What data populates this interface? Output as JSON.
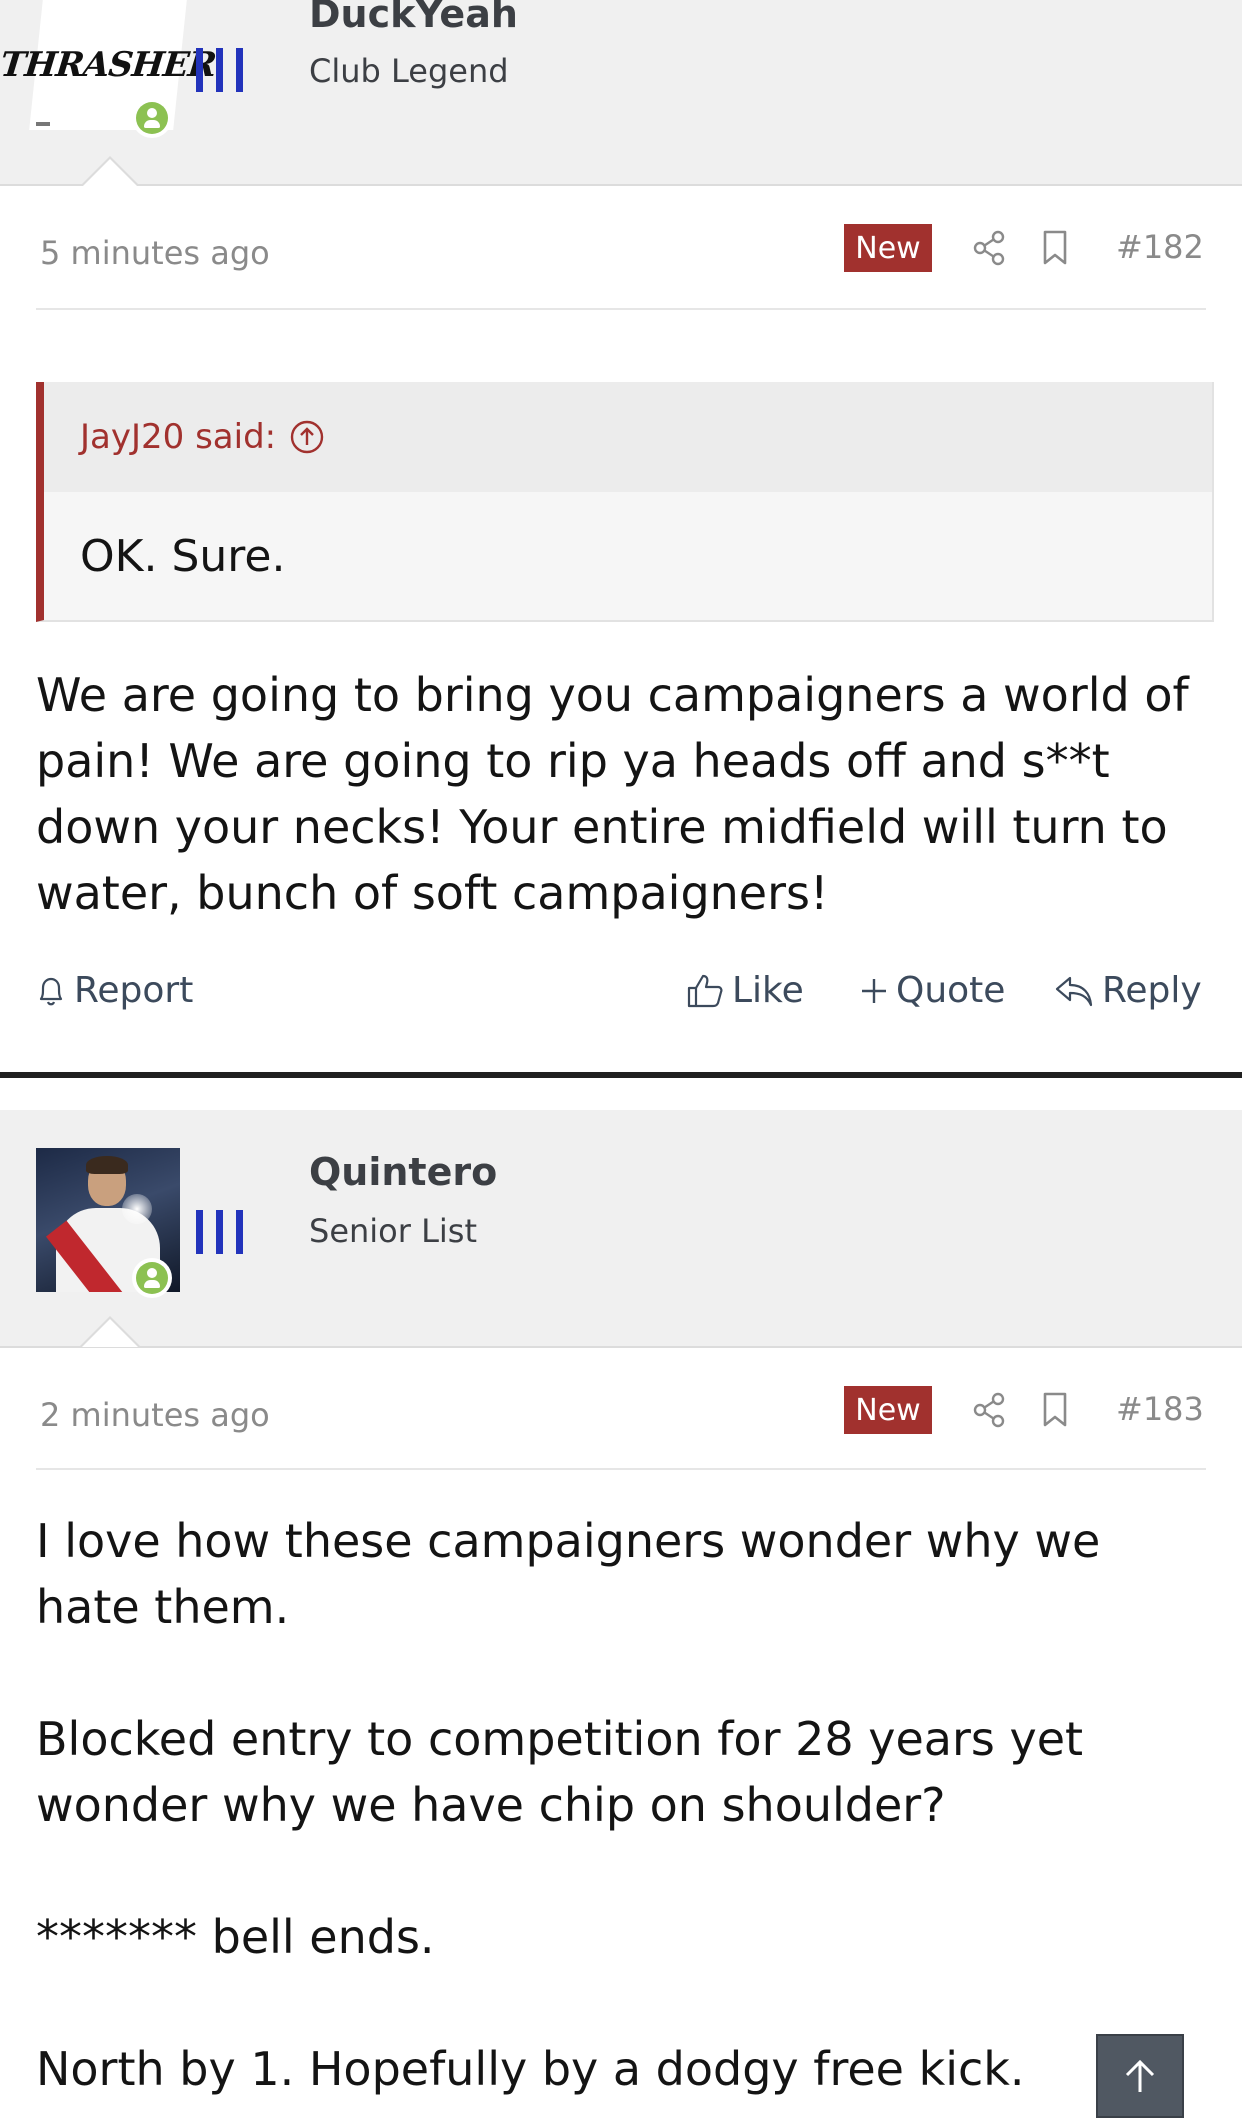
{
  "posts": [
    {
      "username": "DuckYeah",
      "user_title": "Club Legend",
      "avatar_text": "THRASHER",
      "timestamp": "5 minutes ago",
      "badge": "New",
      "number": "#182",
      "quote": {
        "author": "JayJ20 said:",
        "text": "OK. Sure."
      },
      "body": [
        "We are going to bring you campaigners a world of pain! We are going to rip ya heads off and s**t down your necks! Your entire midfield will turn to water, bunch of soft campaigners!"
      ],
      "actions": {
        "report": "Report",
        "like": "Like",
        "quote": "Quote",
        "reply": "Reply"
      }
    },
    {
      "username": "Quintero",
      "user_title": "Senior List",
      "timestamp": "2 minutes ago",
      "badge": "New",
      "number": "#183",
      "body": [
        "I love how these campaigners wonder why we hate them.",
        "Blocked entry to competition for 28 years yet wonder why we have chip on shoulder?",
        "******* bell ends.",
        "North by 1. Hopefully by a dodgy free kick."
      ]
    }
  ],
  "colors": {
    "accent": "#a1312e",
    "online": "#8cc152",
    "flag": "#2233bb"
  },
  "icons": [
    "share-icon",
    "bookmark-icon",
    "bell-icon",
    "thumbs-up-icon",
    "plus-icon",
    "reply-icon",
    "arrow-up-circle-icon",
    "arrow-up-icon"
  ]
}
